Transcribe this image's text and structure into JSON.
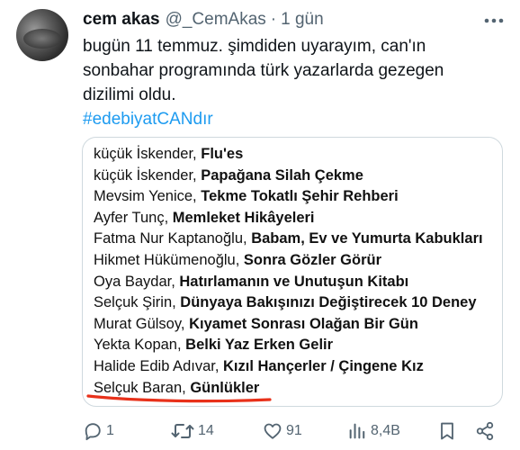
{
  "tweet": {
    "author_name": "cem akas",
    "handle": "@_CemAkas",
    "separator": "·",
    "time": "1 gün",
    "text_lines": [
      "bugün 11 temmuz. şimdiden uyarayım, can'ın",
      "sonbahar programında türk yazarlarda gezegen",
      "dizilimi oldu."
    ],
    "hashtag": "#edebiyatCANdır"
  },
  "books": [
    {
      "author": "küçük İskender, ",
      "title": "Flu'es"
    },
    {
      "author": "küçük İskender, ",
      "title": "Papağana Silah Çekme"
    },
    {
      "author": "Mevsim Yenice, ",
      "title": "Tekme Tokatlı Şehir Rehberi"
    },
    {
      "author": "Ayfer Tunç, ",
      "title": "Memleket Hikâyeleri"
    },
    {
      "author": "Fatma Nur Kaptanoğlu, ",
      "title": "Babam, Ev ve Yumurta Kabukları"
    },
    {
      "author": "Hikmet Hükümenoğlu, ",
      "title": "Sonra Gözler Görür"
    },
    {
      "author": "Oya Baydar, ",
      "title": "Hatırlamanın ve Unutuşun Kitabı"
    },
    {
      "author": "Selçuk Şirin, ",
      "title": "Dünyaya Bakışınızı Değiştirecek 10 Deney"
    },
    {
      "author": "Murat Gülsoy, ",
      "title": "Kıyamet Sonrası Olağan Bir Gün"
    },
    {
      "author": "Yekta Kopan, ",
      "title": "Belki Yaz Erken Gelir"
    },
    {
      "author": "Halide Edib Adıvar, ",
      "title": "Kızıl Hançerler / Çingene Kız"
    },
    {
      "author": "Selçuk Baran, ",
      "title": "Günlükler"
    }
  ],
  "actions": {
    "reply_count": "1",
    "retweet_count": "14",
    "like_count": "91",
    "views_count": "8,4B"
  },
  "icons": {
    "more": "more-icon",
    "reply": "reply-icon",
    "retweet": "retweet-icon",
    "like": "heart-icon",
    "views": "views-icon",
    "bookmark": "bookmark-icon",
    "share": "share-icon"
  },
  "colors": {
    "link": "#1d9bf0",
    "secondary_text": "#536471",
    "underline_annotation": "#e8311a"
  }
}
